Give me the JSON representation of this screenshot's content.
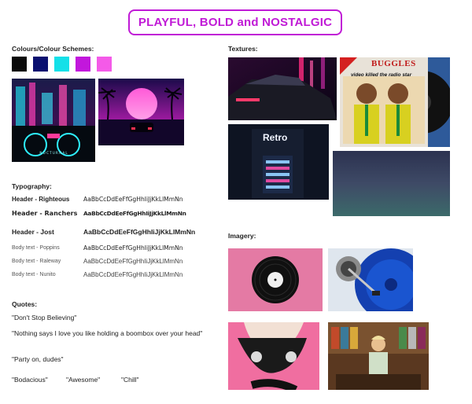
{
  "title": "PLAYFUL, BOLD and NOSTALGIC",
  "colours": {
    "label": "Colours/Colour Schemes:",
    "swatches": [
      "#0a0a0a",
      "#0a1070",
      "#14e0e8",
      "#c217dc",
      "#f45ae8"
    ]
  },
  "textures": {
    "label": "Textures:"
  },
  "record_sleeve": {
    "band": "BUGGLES",
    "song": "video killed the radio star"
  },
  "retro_poster": {
    "word": "Retro"
  },
  "imagery": {
    "label": "Imagery:"
  },
  "typography": {
    "label": "Typography:",
    "rows": [
      {
        "label": "Header - Righteous",
        "sample": "AaBbCcDdEeFfGgHhIiJjKkLlMmNn"
      },
      {
        "label": "Header - Ranchers",
        "sample": "AaBbCcDdEeFfGgHhIiJjKkLlMmNn"
      },
      {
        "label": "Header - Jost",
        "sample": "AaBbCcDdEeFfGgHhIiJjKkLlMmNn"
      },
      {
        "label": "Body text - Poppins",
        "sample": "AaBbCcDdEeFfGgHhIiJjKkLlMmNn"
      },
      {
        "label": "Body text - Raleway",
        "sample": "AaBbCcDdEeFfGgHhIiJjKkLlMmNn"
      },
      {
        "label": "Body text - Nunito",
        "sample": "AaBbCcDdEeFfGgHhIiJjKkLlMmNn"
      }
    ]
  },
  "quotes": {
    "label": "Quotes:",
    "q1": "\"Don't Stop Believing\"",
    "q2": "\"Nothing says I love you like holding a boombox over your head\"",
    "q3": "\"Party on, dudes\"",
    "q4": "\"Bodacious\"",
    "q5": "\"Awesome\"",
    "q6": "\"Chill\""
  }
}
